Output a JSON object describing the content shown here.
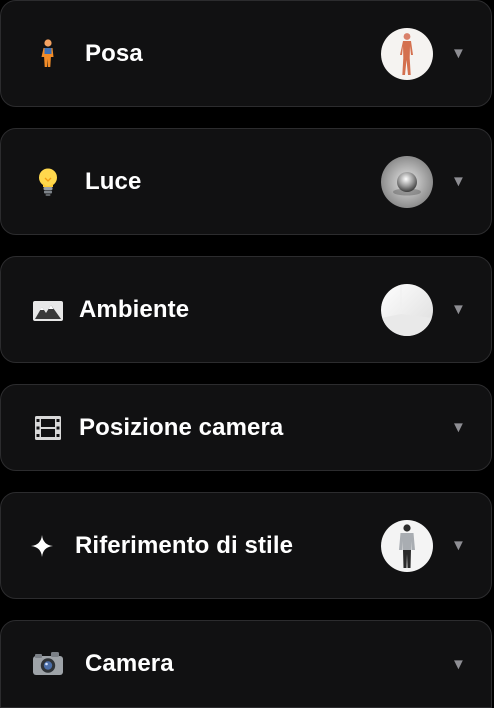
{
  "sections": [
    {
      "label": "Posa",
      "icon": "person-icon",
      "has_thumbnail": true,
      "thumbnail": "pose-figure"
    },
    {
      "label": "Luce",
      "icon": "lightbulb-icon",
      "has_thumbnail": true,
      "thumbnail": "chrome-sphere"
    },
    {
      "label": "Ambiente",
      "icon": "mountain-icon",
      "has_thumbnail": true,
      "thumbnail": "white-room"
    },
    {
      "label": "Posizione camera",
      "icon": "film-frame-icon",
      "has_thumbnail": false
    },
    {
      "label": "Riferimento di stile",
      "icon": "sparkle-icon",
      "has_thumbnail": true,
      "thumbnail": "person-reference"
    },
    {
      "label": "Camera",
      "icon": "camera-icon",
      "has_thumbnail": false
    }
  ],
  "chevron": "▼",
  "colors": {
    "background": "#000000",
    "panel": "#111112",
    "panel_border": "#2c2c2e",
    "text": "#ffffff",
    "chevron": "#8e8e93"
  }
}
